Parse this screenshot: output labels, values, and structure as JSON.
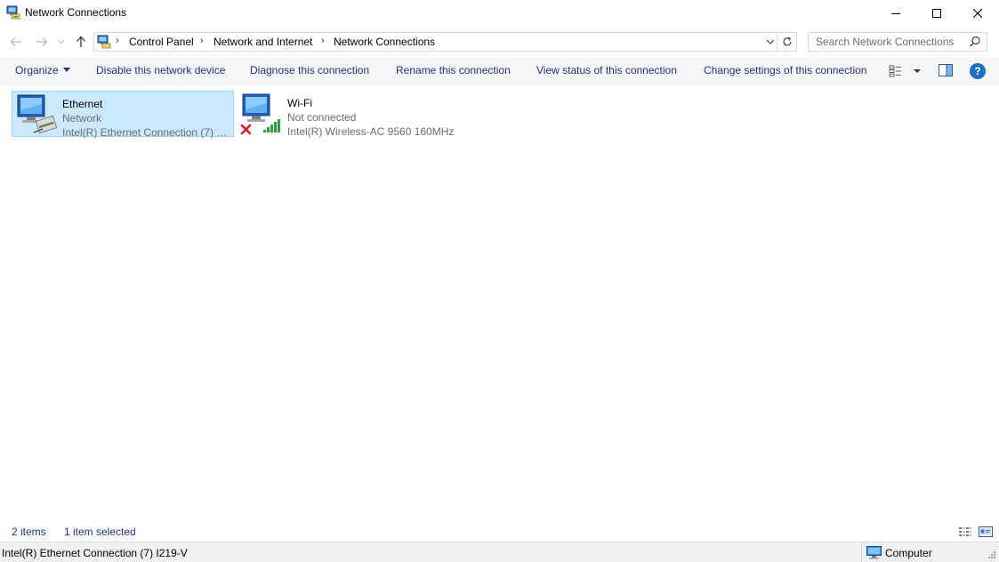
{
  "window": {
    "title": "Network Connections",
    "icon": "network-connections-icon"
  },
  "navigation": {
    "breadcrumbs": [
      "Control Panel",
      "Network and Internet",
      "Network Connections"
    ],
    "search_placeholder": "Search Network Connections"
  },
  "toolbar": {
    "organize": "Organize",
    "disable": "Disable this network device",
    "diagnose": "Diagnose this connection",
    "rename": "Rename this connection",
    "view_status": "View status of this connection",
    "change_settings": "Change settings of this connection",
    "help": "?"
  },
  "items": [
    {
      "name": "Ethernet",
      "status": "Network",
      "device": "Intel(R) Ethernet Connection (7) I219-V",
      "selected": true
    },
    {
      "name": "Wi-Fi",
      "status": "Not connected",
      "device": "Intel(R) Wireless-AC 9560 160MHz",
      "selected": false
    }
  ],
  "statusbar": {
    "count": "2 items",
    "selected": "1 item selected"
  },
  "infobar": {
    "selection_detail": "Intel(R) Ethernet Connection (7) I219-V",
    "location": "Computer"
  },
  "colors": {
    "link": "#1e3287",
    "selection_bg": "#cce8ff",
    "selection_border": "#99d1ff",
    "toolbar_bg": "#f5f6f7",
    "error": "#e81123",
    "signal": "#2e9e3e"
  }
}
